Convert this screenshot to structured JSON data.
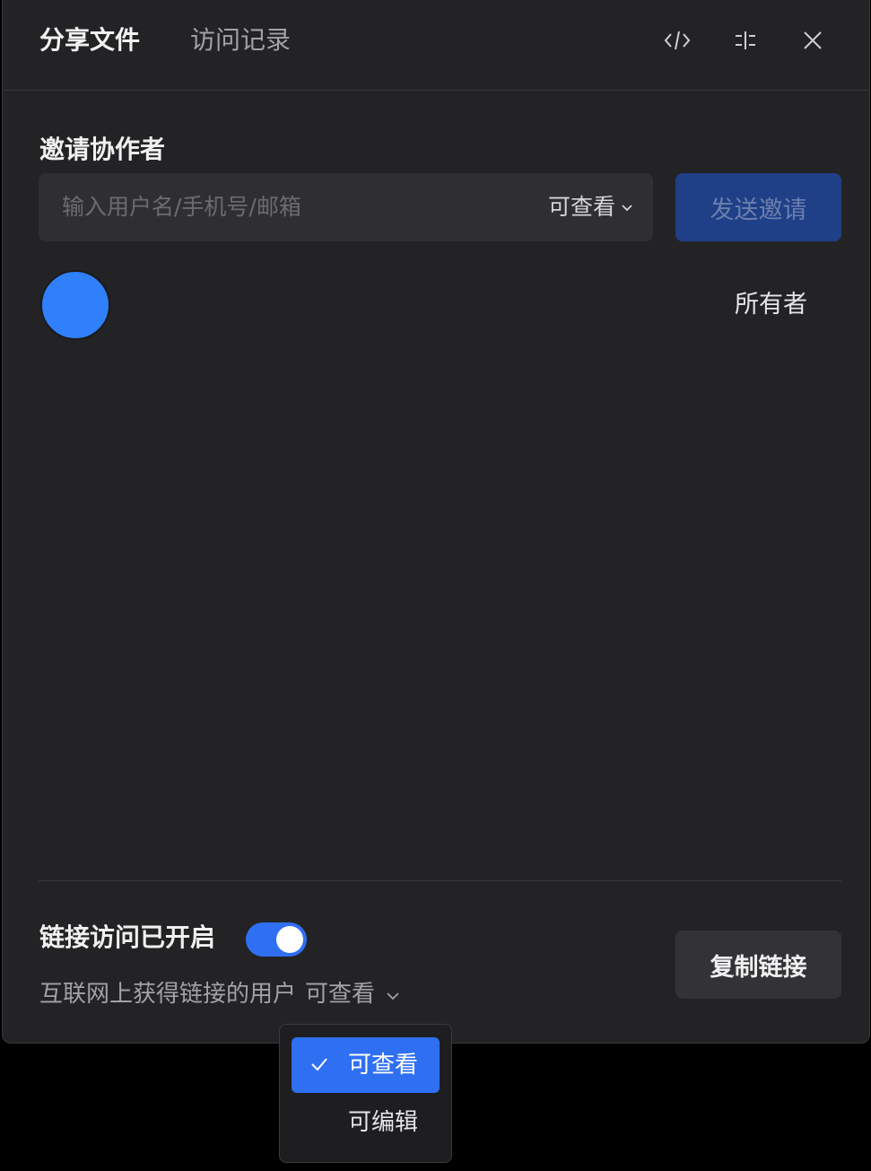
{
  "header": {
    "tabs": [
      {
        "label": "分享文件",
        "active": true
      },
      {
        "label": "访问记录",
        "active": false
      }
    ],
    "icons": [
      "code-icon",
      "sliders-icon",
      "close-icon"
    ]
  },
  "invite": {
    "title": "邀请协作者",
    "placeholder": "输入用户名/手机号/邮箱",
    "permission": "可查看",
    "send_label": "发送邀请"
  },
  "members": [
    {
      "avatar_color": "#2f80fa",
      "role": "所有者"
    }
  ],
  "link_access": {
    "title": "链接访问已开启",
    "enabled": true,
    "description": "互联网上获得链接的用户",
    "permission": "可查看",
    "copy_label": "复制链接"
  },
  "permission_menu": {
    "options": [
      {
        "label": "可查看",
        "selected": true
      },
      {
        "label": "可编辑",
        "selected": false
      }
    ]
  },
  "colors": {
    "accent": "#2f6ff2",
    "panel_bg": "#232325",
    "avatar": "#2f80fa"
  }
}
